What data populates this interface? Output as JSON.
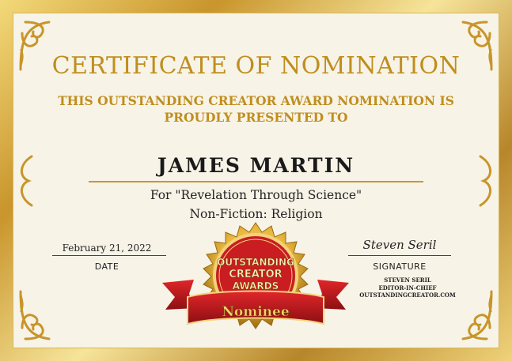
{
  "certificate": {
    "title": "CERTIFICATE OF NOMINATION",
    "subtitle_line1": "THIS OUTSTANDING CREATOR AWARD NOMINATION IS",
    "subtitle_line2": "PROUDLY PRESENTED TO",
    "recipient": "JAMES MARTIN",
    "work_title": "For \"Revelation Through Science\"",
    "category": "Non-Fiction: Religion",
    "date_value": "February 21, 2022",
    "date_label": "DATE",
    "signature_value": "Steven Seril",
    "signature_label": "SIGNATURE",
    "editor_name": "STEVEN SERIL",
    "editor_role": "EDITOR-IN-CHIEF",
    "editor_site": "OUTSTANDINGCREATOR.COM"
  },
  "seal": {
    "line1": "OUTSTANDING",
    "line2": "CREATOR",
    "line3": "AWARDS",
    "ribbon": "Nominee"
  },
  "colors": {
    "gold": "#c08e1e",
    "ribbon_red": "#b3161b",
    "paper": "#f7f3e7"
  }
}
